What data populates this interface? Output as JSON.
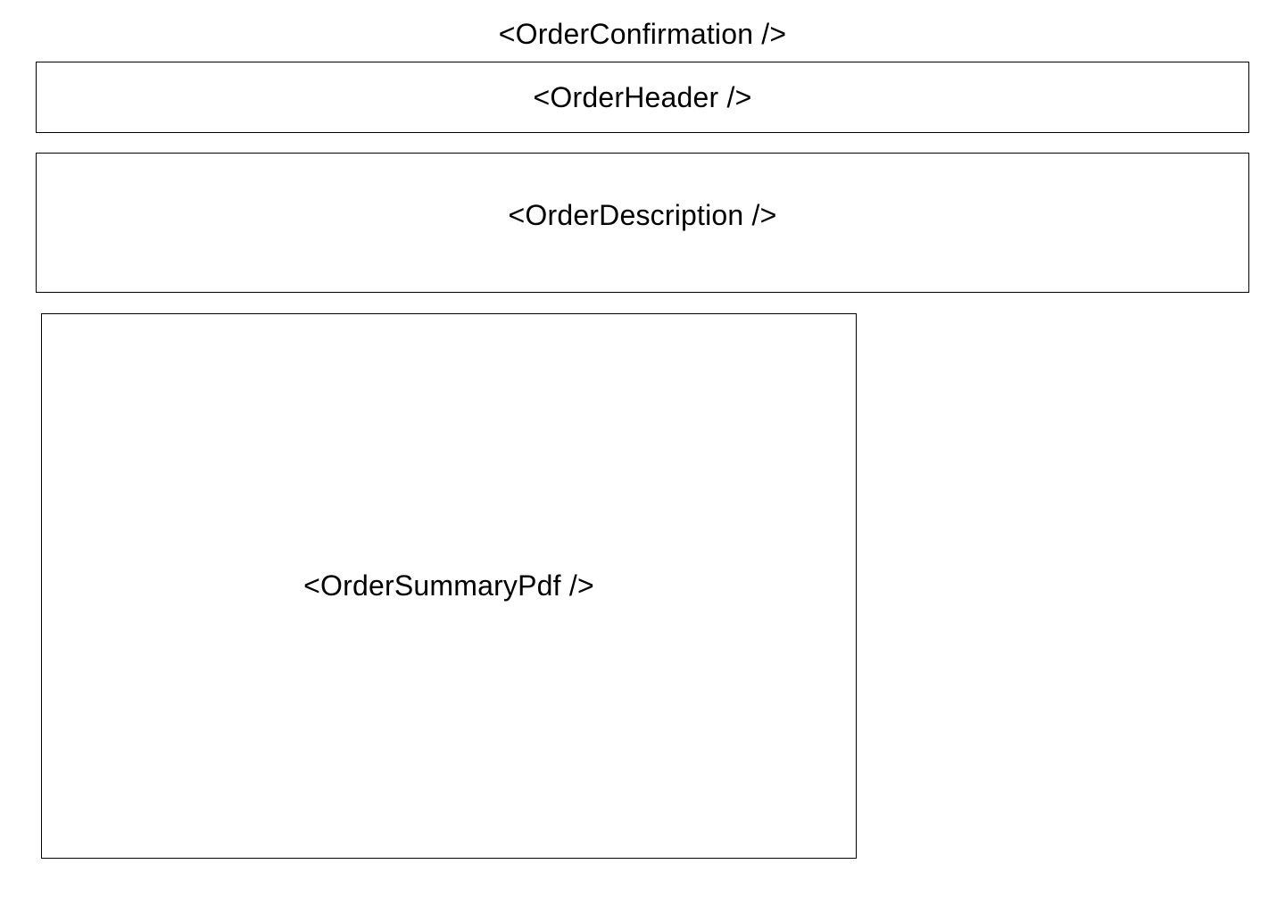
{
  "page": {
    "title": "<OrderConfirmation />"
  },
  "components": {
    "header": "<OrderHeader />",
    "description": "<OrderDescription />",
    "summary_pdf": "<OrderSummaryPdf />"
  },
  "colors": {
    "border": "#000000",
    "background": "#ffffff",
    "text": "#000000"
  }
}
